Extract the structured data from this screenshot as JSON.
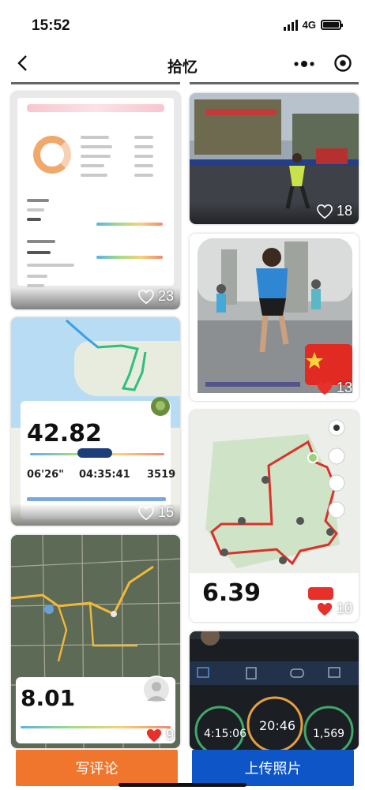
{
  "status_bar": {
    "time": "15:52",
    "network": "4G"
  },
  "nav": {
    "title": "拾忆"
  },
  "feed": {
    "left": [
      {
        "likes": "23"
      },
      {
        "likes": "15",
        "distance": "42.82",
        "pace": "06'26\"",
        "duration": "04:35:41",
        "cadence": "3519"
      },
      {
        "likes": "9",
        "distance": "8.01"
      }
    ],
    "right": [
      {
        "likes": "18"
      },
      {
        "likes": "13"
      },
      {
        "likes": "10",
        "distance": "6.39"
      },
      {
        "time_a": "4:15:06",
        "time_b": "20:46",
        "count": "1,569"
      }
    ]
  },
  "actions": {
    "comment_label": "写评论",
    "upload_label": "上传照片"
  },
  "colors": {
    "comment_button": "#f0762e",
    "upload_button": "#0e56c8",
    "route_red": "#d8322b",
    "like_red": "#e8302a"
  }
}
